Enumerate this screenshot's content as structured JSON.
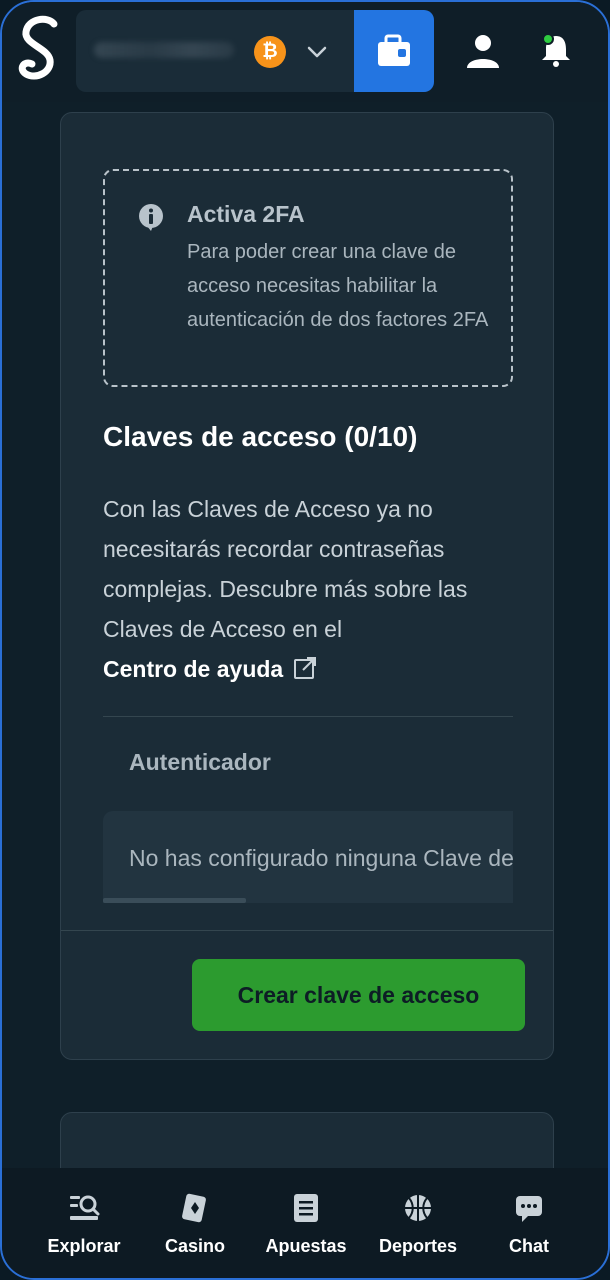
{
  "header": {
    "logo_icon": "sportsbook-s-logo",
    "currency_icon": "bitcoin-icon",
    "currency_symbol": "₿",
    "dropdown_icon": "chevron-down-icon",
    "wallet_icon": "wallet-icon",
    "user_icon": "user-icon",
    "notifications_icon": "bell-icon",
    "notification_dot_color": "#2ecc40",
    "accent_color": "#2375e1"
  },
  "twofa_notice": {
    "title": "Activa 2FA",
    "text": "Para poder crear una clave de acceso necesitas habilitar la autenticación de dos factores 2FA"
  },
  "passkeys": {
    "title": "Claves de acceso (0/10)",
    "description": "Con las Claves de Acceso ya no necesitarás recordar contraseñas complejas. Descubre más sobre las Claves de Acceso en el",
    "help_link": "Centro de ayuda",
    "table": {
      "column_header": "Autenticador",
      "empty_message": "No has configurado ninguna Clave de acceso"
    },
    "create_button": "Crear clave de acceso",
    "create_button_color": "#2c9b2f"
  },
  "bottom_nav": {
    "items": [
      {
        "label": "Explorar",
        "icon": "explore-icon"
      },
      {
        "label": "Casino",
        "icon": "casino-cards-icon"
      },
      {
        "label": "Apuestas",
        "icon": "betslip-icon"
      },
      {
        "label": "Deportes",
        "icon": "basketball-icon"
      },
      {
        "label": "Chat",
        "icon": "chat-icon"
      }
    ]
  }
}
